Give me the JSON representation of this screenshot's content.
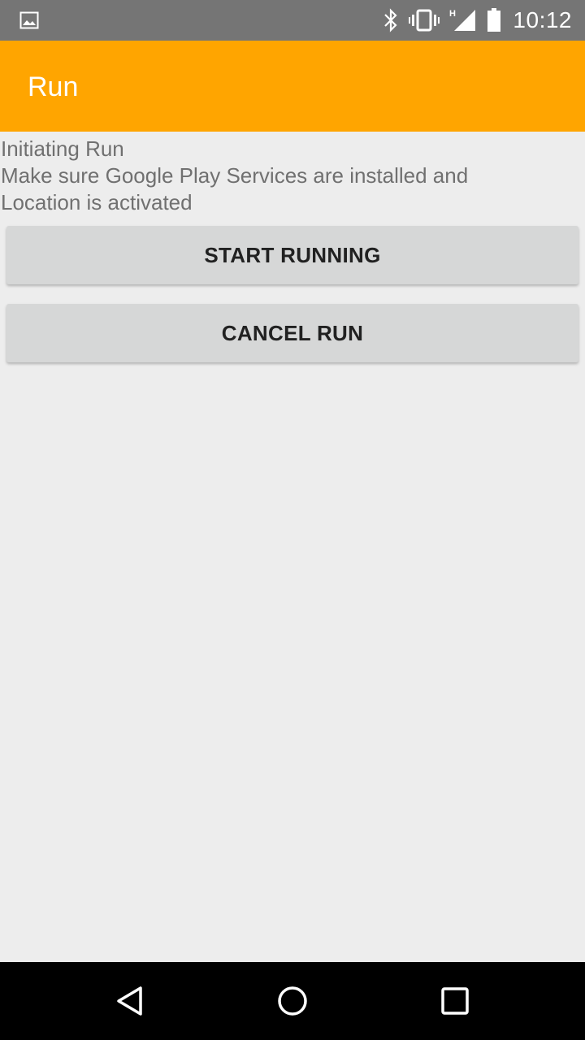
{
  "status_bar": {
    "time": "10:12",
    "icons": [
      "gallery-icon",
      "bluetooth-icon",
      "vibrate-icon",
      "signal-icon",
      "battery-icon"
    ]
  },
  "app_bar": {
    "title": "Run"
  },
  "content": {
    "lines": [
      "Initiating Run",
      "Make sure Google Play Services are installed and",
      "Location is activated"
    ]
  },
  "buttons": {
    "start": "START RUNNING",
    "cancel": "CANCEL RUN"
  },
  "nav_bar": {
    "icons": [
      "back-icon",
      "home-icon",
      "recents-icon"
    ]
  },
  "colors": {
    "status_bar": "#757575",
    "app_bar": "#ffa500",
    "background": "#ededed",
    "button": "#d6d7d7",
    "nav_bar": "#000000"
  }
}
